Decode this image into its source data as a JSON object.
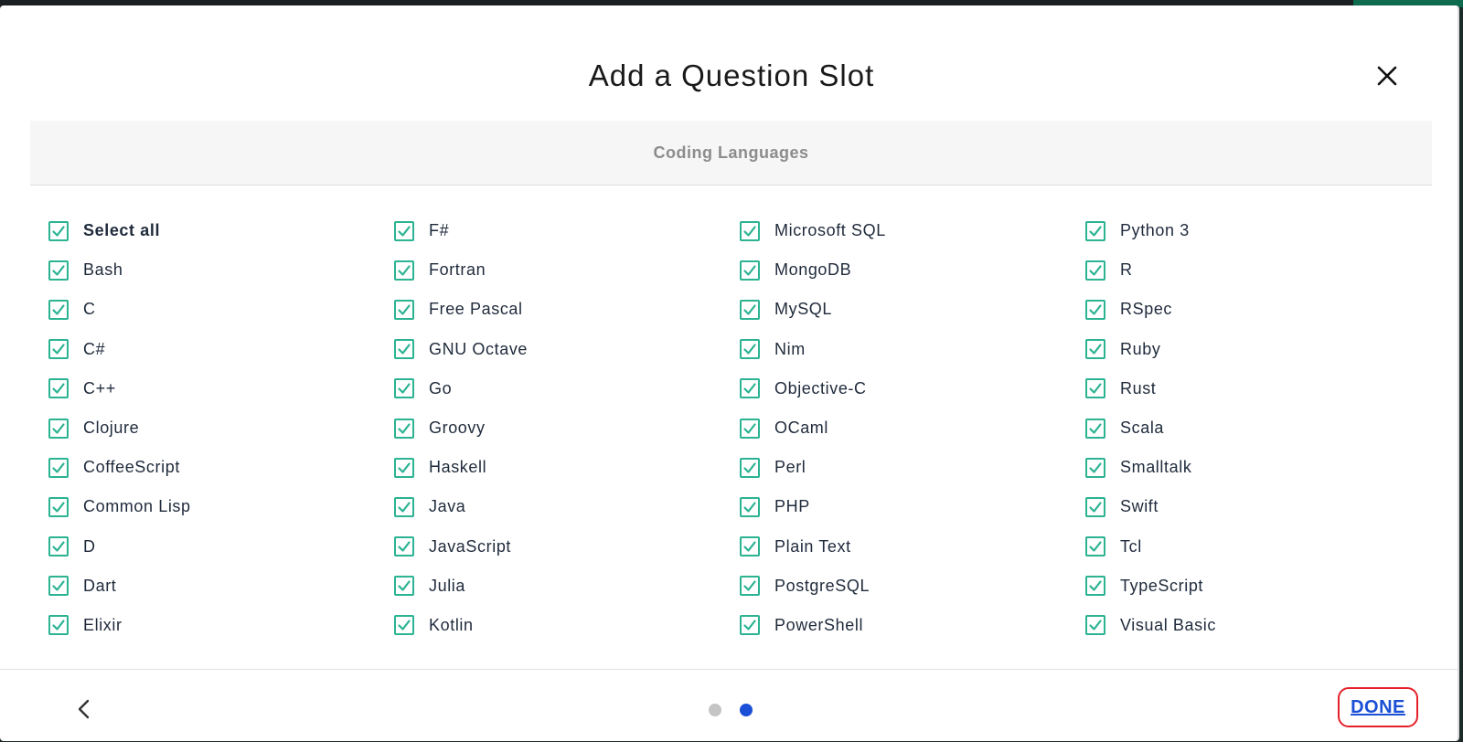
{
  "modal": {
    "title": "Add a Question Slot",
    "section_title": "Coding Languages"
  },
  "options": [
    {
      "label": "Select all",
      "checked": true
    },
    {
      "label": "Bash",
      "checked": true
    },
    {
      "label": "C",
      "checked": true
    },
    {
      "label": "C#",
      "checked": true
    },
    {
      "label": "C++",
      "checked": true
    },
    {
      "label": "Clojure",
      "checked": true
    },
    {
      "label": "CoffeeScript",
      "checked": true
    },
    {
      "label": "Common Lisp",
      "checked": true
    },
    {
      "label": "D",
      "checked": true
    },
    {
      "label": "Dart",
      "checked": true
    },
    {
      "label": "Elixir",
      "checked": true
    },
    {
      "label": "F#",
      "checked": true
    },
    {
      "label": "Fortran",
      "checked": true
    },
    {
      "label": "Free Pascal",
      "checked": true
    },
    {
      "label": "GNU Octave",
      "checked": true
    },
    {
      "label": "Go",
      "checked": true
    },
    {
      "label": "Groovy",
      "checked": true
    },
    {
      "label": "Haskell",
      "checked": true
    },
    {
      "label": "Java",
      "checked": true
    },
    {
      "label": "JavaScript",
      "checked": true
    },
    {
      "label": "Julia",
      "checked": true
    },
    {
      "label": "Kotlin",
      "checked": true
    },
    {
      "label": "Microsoft SQL",
      "checked": true
    },
    {
      "label": "MongoDB",
      "checked": true
    },
    {
      "label": "MySQL",
      "checked": true
    },
    {
      "label": "Nim",
      "checked": true
    },
    {
      "label": "Objective-C",
      "checked": true
    },
    {
      "label": "OCaml",
      "checked": true
    },
    {
      "label": "Perl",
      "checked": true
    },
    {
      "label": "PHP",
      "checked": true
    },
    {
      "label": "Plain Text",
      "checked": true
    },
    {
      "label": "PostgreSQL",
      "checked": true
    },
    {
      "label": "PowerShell",
      "checked": true
    },
    {
      "label": "Python 3",
      "checked": true
    },
    {
      "label": "R",
      "checked": true
    },
    {
      "label": "RSpec",
      "checked": true
    },
    {
      "label": "Ruby",
      "checked": true
    },
    {
      "label": "Rust",
      "checked": true
    },
    {
      "label": "Scala",
      "checked": true
    },
    {
      "label": "Smalltalk",
      "checked": true
    },
    {
      "label": "Swift",
      "checked": true
    },
    {
      "label": "Tcl",
      "checked": true
    },
    {
      "label": "TypeScript",
      "checked": true
    },
    {
      "label": "Visual Basic",
      "checked": true
    }
  ],
  "footer": {
    "done_label": "DONE",
    "pagination": {
      "total_pages": 2,
      "current_page": 2
    }
  },
  "icons": {
    "close": "close-icon",
    "back": "chevron-left-icon",
    "check": "checkmark-icon"
  },
  "colors": {
    "checkbox_accent": "#2bb392",
    "done_link": "#1a4fd6",
    "highlight_outline": "#e5202a",
    "dot_active": "#1a4fd6",
    "dot_inactive": "#c4c4c4",
    "section_header_bg": "#f6f6f6"
  }
}
